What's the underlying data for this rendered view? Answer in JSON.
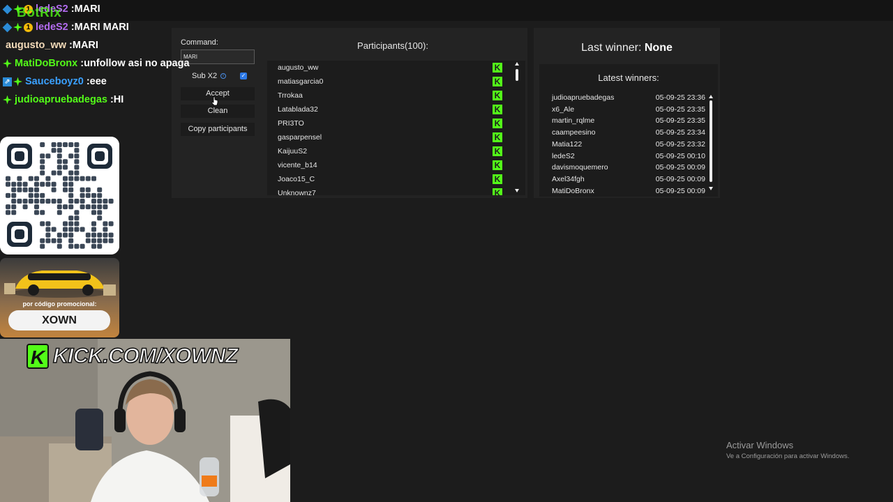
{
  "overlay_logo": "BotRix",
  "chat": [
    {
      "badges": [
        "blue",
        "green",
        "gold"
      ],
      "user": "ledeS2",
      "user_color": "#b36cf0",
      "message": "MARI"
    },
    {
      "badges": [
        "blue",
        "green",
        "gold"
      ],
      "user": "ledeS2",
      "user_color": "#b36cf0",
      "message": "MARI MARI"
    },
    {
      "badges": [],
      "user": "augusto_ww",
      "user_color": "#f2d9b8",
      "message": "MARI"
    },
    {
      "badges": [
        "green"
      ],
      "user": "MatiDoBronx",
      "user_color": "#53fc18",
      "message": "unfollow asi no apaga"
    },
    {
      "badges": [
        "prime",
        "green"
      ],
      "user": "Sauceboyz0",
      "user_color": "#3aa0ff",
      "message": "eee"
    },
    {
      "badges": [
        "green"
      ],
      "user": "judioapruebadegas",
      "user_color": "#53fc18",
      "message": "HI"
    }
  ],
  "promo": {
    "label": "por código promocional:",
    "code": "XOWN"
  },
  "webcam": {
    "banner": "KICK.COM/XOWNZ"
  },
  "giveaway": {
    "command_label": "Command:",
    "command_value": "MARI",
    "sub_label": "Sub X2",
    "sub_checked": true,
    "accept_label": "Accept",
    "clean_label": "Clean",
    "copy_label": "Copy participants",
    "participants_title": "Participants(100):",
    "participants": [
      "augusto_ww",
      "matiasgarcia0",
      "Trrokaa",
      "Latablada32",
      "PRI3TO",
      "gasparpensel",
      "KaijuuS2",
      "vicente_b14",
      "Joaco15_C",
      "Unknownz7"
    ]
  },
  "winners": {
    "last_winner_label": "Last winner:",
    "last_winner_value": "None",
    "latest_title": "Latest winners:",
    "list": [
      {
        "name": "judioapruebadegas",
        "time": "05-09-25 23:36"
      },
      {
        "name": "x6_Ale",
        "time": "05-09-25 23:35"
      },
      {
        "name": "martin_rqlme",
        "time": "05-09-25 23:35"
      },
      {
        "name": "caampeesino",
        "time": "05-09-25 23:34"
      },
      {
        "name": "Matia122",
        "time": "05-09-25 23:32"
      },
      {
        "name": "ledeS2",
        "time": "05-09-25 00:10"
      },
      {
        "name": "davismoquemero",
        "time": "05-09-25 00:09"
      },
      {
        "name": "Axel34fgh",
        "time": "05-09-25 00:09"
      },
      {
        "name": "MatiDoBronx",
        "time": "05-09-25 00:09"
      }
    ]
  },
  "windows_watermark": {
    "title": "Activar Windows",
    "subtitle": "Ve a Configuración para activar Windows."
  },
  "colors": {
    "kick_green": "#53fc18",
    "panel_bg": "#232323",
    "page_bg": "#1c1c1c"
  }
}
